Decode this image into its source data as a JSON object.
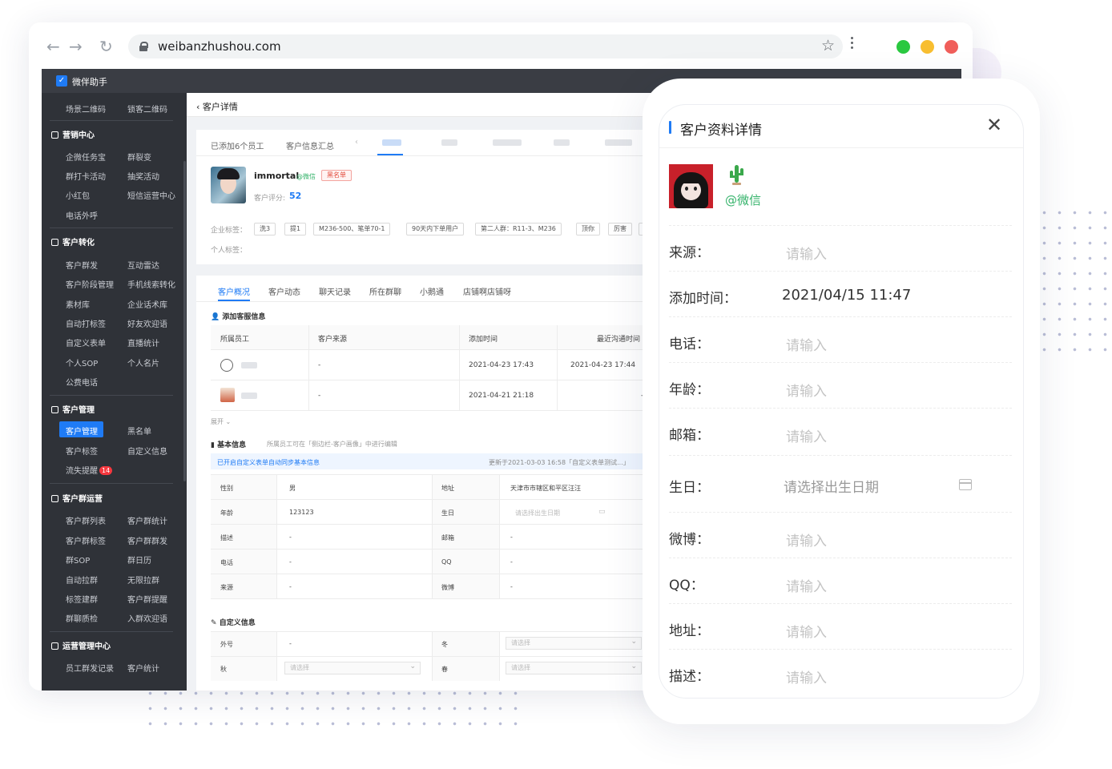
{
  "browser": {
    "url": "weibanzhushou.com",
    "traffic_colors": [
      "#2ac840",
      "#f8be30",
      "#f05e5a"
    ]
  },
  "app": {
    "name": "微伴助手",
    "accent": "#1f7bf5"
  },
  "sidebar": {
    "top_items": [
      "场景二维码",
      "锁客二维码"
    ],
    "sections": [
      {
        "title": "营销中心",
        "items": [
          "企微任务宝",
          "群裂变",
          "群打卡活动",
          "抽奖活动",
          "小红包",
          "短信运营中心",
          "电话外呼"
        ]
      },
      {
        "title": "客户转化",
        "items": [
          "客户群发",
          "互动雷达",
          "客户阶段管理",
          "手机线索转化",
          "素材库",
          "企业话术库",
          "自动打标签",
          "好友欢迎语",
          "自定义表单",
          "直播统计",
          "个人SOP",
          "个人名片",
          "公费电话"
        ]
      },
      {
        "title": "客户管理",
        "items": [
          "客户管理",
          "黑名单",
          "客户标签",
          "自定义信息",
          "流失提醒"
        ],
        "badge": "14"
      },
      {
        "title": "客户群运营",
        "items": [
          "客户群列表",
          "客户群统计",
          "客户群标签",
          "客户群群发",
          "群SOP",
          "群日历",
          "自动拉群",
          "无限拉群",
          "标签建群",
          "客户群提醒",
          "群聊质检",
          "入群欢迎语"
        ]
      },
      {
        "title": "运营管理中心",
        "items": [
          "员工群发记录",
          "客户统计"
        ]
      }
    ]
  },
  "main": {
    "breadcrumb": "客户详情",
    "tabs": [
      "已添加6个员工",
      "客户信息汇总"
    ],
    "customer": {
      "name": "immortal",
      "source_tag": "@微信",
      "blacklist_tag": "黑名单",
      "score_label": "客户评分:",
      "score": "52",
      "company_tags_label": "企业标签：",
      "company_tags": [
        "洗3",
        "提1",
        "M236-500、笔单70-1",
        "90天内下单用户",
        "第二人群：R11-3、M236",
        "顶你",
        "厉害"
      ],
      "personal_tags_label": "个人标签："
    },
    "sub_tabs": [
      "客户概况",
      "客户动态",
      "聊天记录",
      "所在群聊",
      "小鹅通",
      "店铺啊店铺呀"
    ],
    "service": {
      "title": "添加客服信息",
      "headers": [
        "所属员工",
        "客户来源",
        "添加时间",
        "最近沟通时间"
      ],
      "rows": [
        {
          "source": "-",
          "added": "2021-04-23 17:43",
          "last": "2021-04-23 17:44"
        },
        {
          "source": "-",
          "added": "2021-04-21 21:18",
          "last": "-"
        }
      ],
      "expand": "展开"
    },
    "basic": {
      "title": "基本信息",
      "hint": "所属员工可在「侧边栏-客户画像」中进行编辑",
      "sync_note": "已开启自定义表单自动同步基本信息",
      "updated": "更新于2021-03-03 16:58「自定义表单测试...」",
      "rows": [
        {
          "l1": "性别",
          "v1": "男",
          "l2": "地址",
          "v2": "天津市市辖区和平区汪汪"
        },
        {
          "l1": "年龄",
          "v1": "123123",
          "l2": "生日",
          "v2": "请选择出生日期"
        },
        {
          "l1": "描述",
          "v1": "-",
          "l2": "邮箱",
          "v2": "-"
        },
        {
          "l1": "电话",
          "v1": "-",
          "l2": "QQ",
          "v2": "-"
        },
        {
          "l1": "来源",
          "v1": "-",
          "l2": "微博",
          "v2": "-"
        }
      ]
    },
    "custom": {
      "title": "自定义信息",
      "rows": [
        {
          "l1": "外号",
          "v1": "-",
          "l2": "冬",
          "v2": "请选择"
        },
        {
          "l1": "秋",
          "v1": "请选择",
          "l2": "春",
          "v2": "请选择"
        }
      ]
    }
  },
  "modal": {
    "title": "客户资料详情",
    "wechat_tag": "@微信",
    "fields": [
      {
        "label": "来源：",
        "placeholder": "请输入"
      },
      {
        "label": "添加时间：",
        "value": "2021/04/15 11:47"
      },
      {
        "label": "电话：",
        "placeholder": "请输入"
      },
      {
        "label": "年龄：",
        "placeholder": "请输入"
      },
      {
        "label": "邮箱：",
        "placeholder": "请输入"
      },
      {
        "label": "生日：",
        "placeholder": "请选择出生日期"
      },
      {
        "label": "微博：",
        "placeholder": "请输入"
      },
      {
        "label": "QQ：",
        "placeholder": "请输入"
      },
      {
        "label": "地址：",
        "placeholder": "请输入"
      },
      {
        "label": "描述：",
        "placeholder": "请输入"
      }
    ]
  }
}
